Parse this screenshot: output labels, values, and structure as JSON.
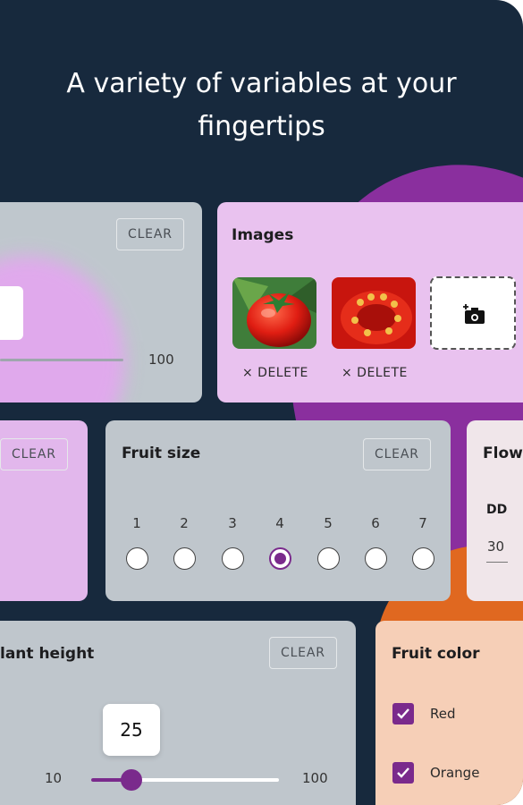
{
  "headline": {
    "line1": "A variety of variables at your",
    "line2": "fingertips"
  },
  "range_card": {
    "clear_label": "CLEAR",
    "max_label": "100"
  },
  "images_card": {
    "title": "Images",
    "delete_label_1": "× DELETE",
    "delete_label_2": "× DELETE",
    "add_photo_icon": "add-photo-icon"
  },
  "left_card": {
    "clear_label": "CLEAR"
  },
  "fruit_size": {
    "title": "Fruit size",
    "clear_label": "CLEAR",
    "options": [
      "1",
      "2",
      "3",
      "4",
      "5",
      "6",
      "7"
    ],
    "selected": "4"
  },
  "flower_card": {
    "title": "Flow",
    "field_label": "DD",
    "field_value": "30"
  },
  "plant_height": {
    "title": "lant height",
    "clear_label": "CLEAR",
    "min_label": "10",
    "max_label": "100",
    "value": "25"
  },
  "fruit_color": {
    "title": "Fruit color",
    "options": [
      {
        "label": "Red",
        "checked": true
      },
      {
        "label": "Orange",
        "checked": true
      }
    ]
  },
  "colors": {
    "background": "#17293d",
    "accent_purple": "#7a2a8c",
    "accent_orange": "#e06820"
  }
}
